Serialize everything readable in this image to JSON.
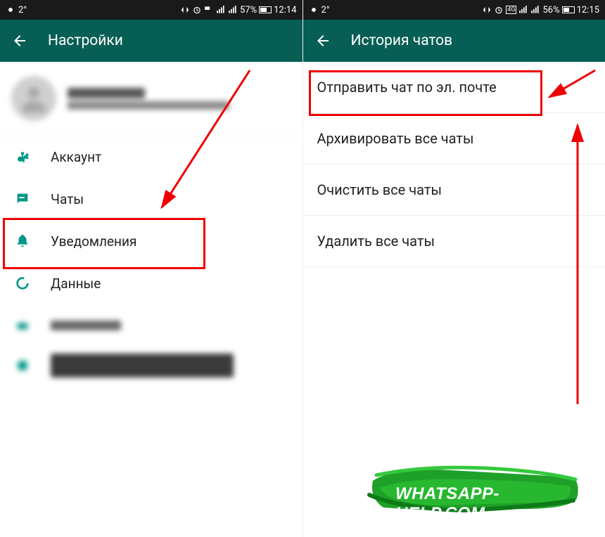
{
  "left_screen": {
    "status": {
      "temp": "2°",
      "battery": "57%",
      "time": "12:14"
    },
    "header": {
      "title": "Настройки"
    },
    "menu": {
      "account": "Аккаунт",
      "chats": "Чаты",
      "notifications": "Уведомления",
      "data": "Данные"
    }
  },
  "right_screen": {
    "status": {
      "temp": "2°",
      "battery": "56%",
      "time": "12:15",
      "net": "4G"
    },
    "header": {
      "title": "История чатов"
    },
    "list": {
      "email": "Отправить чат по эл. почте",
      "archive": "Архивировать все чаты",
      "clear": "Очистить все чаты",
      "delete": "Удалить все чаты"
    }
  },
  "watermark": "WHATSAPP-HELP.COM"
}
